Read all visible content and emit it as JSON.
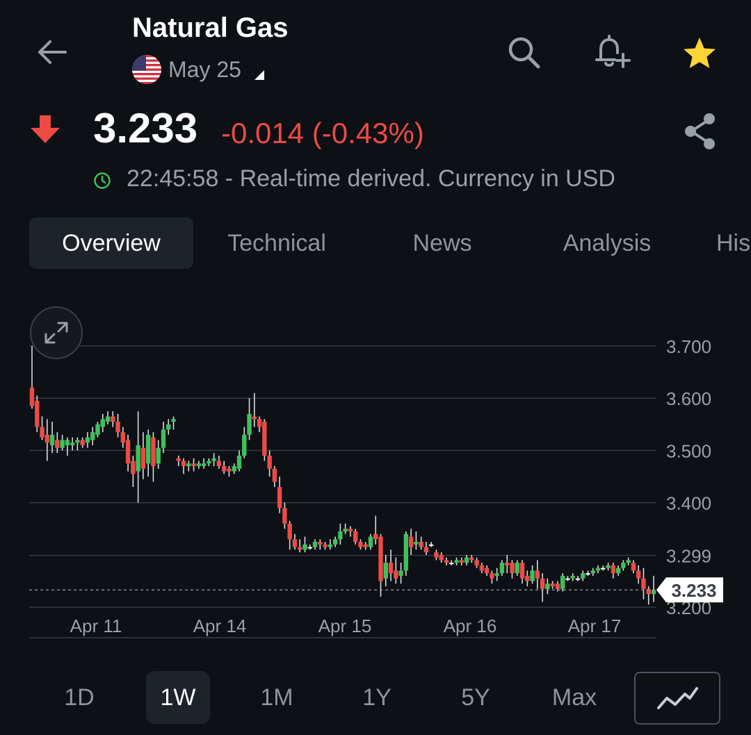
{
  "header": {
    "title": "Natural Gas",
    "contract": "May 25",
    "back_icon": "arrow-left-icon",
    "search_icon": "search-icon",
    "alert_icon": "bell-plus-icon",
    "favorite_icon": "star-icon",
    "favorite_color": "#fcd535"
  },
  "quote": {
    "price": "3.233",
    "change": "-0.014 (-0.43%)",
    "direction_icon": "arrow-down-icon",
    "down_color": "#ec4b45",
    "up_color": "#3ec15a",
    "time": "22:45:58",
    "status_text": "22:45:58 - Real-time derived. Currency in USD",
    "share_icon": "share-icon"
  },
  "tabs": [
    {
      "label": "Overview",
      "active": true
    },
    {
      "label": "Technical",
      "active": false
    },
    {
      "label": "News",
      "active": false
    },
    {
      "label": "Analysis",
      "active": false
    },
    {
      "label": "His",
      "active": false
    }
  ],
  "chart_data": {
    "type": "candlestick",
    "y_ticks": [
      "3.700",
      "3.600",
      "3.500",
      "3.400",
      "3.299",
      "3.200"
    ],
    "ylim": [
      3.2,
      3.7
    ],
    "x_ticks": [
      "Apr 11",
      "Apr 14",
      "Apr 15",
      "Apr 16",
      "Apr 17"
    ],
    "last_price_label": "3.233",
    "last_price": 3.233,
    "grid": true,
    "candles": [
      [
        3.62,
        3.585,
        3.7,
        3.58
      ],
      [
        3.595,
        3.545,
        3.605,
        3.535
      ],
      [
        3.545,
        3.525,
        3.565,
        3.52
      ],
      [
        3.53,
        3.515,
        3.56,
        3.48
      ],
      [
        3.51,
        3.53,
        3.555,
        3.495
      ],
      [
        3.52,
        3.505,
        3.535,
        3.495
      ],
      [
        3.505,
        3.52,
        3.53,
        3.5
      ],
      [
        3.51,
        3.52,
        3.525,
        3.49
      ],
      [
        3.51,
        3.515,
        3.525,
        3.5
      ],
      [
        3.515,
        3.52,
        3.525,
        3.5
      ],
      [
        3.52,
        3.51,
        3.525,
        3.505
      ],
      [
        3.515,
        3.525,
        3.535,
        3.505
      ],
      [
        3.52,
        3.535,
        3.545,
        3.51
      ],
      [
        3.53,
        3.55,
        3.555,
        3.525
      ],
      [
        3.545,
        3.56,
        3.57,
        3.535
      ],
      [
        3.555,
        3.565,
        3.575,
        3.55
      ],
      [
        3.565,
        3.555,
        3.575,
        3.545
      ],
      [
        3.555,
        3.535,
        3.57,
        3.525
      ],
      [
        3.535,
        3.515,
        3.545,
        3.505
      ],
      [
        3.52,
        3.475,
        3.53,
        3.46
      ],
      [
        3.48,
        3.455,
        3.49,
        3.43
      ],
      [
        3.46,
        3.51,
        3.575,
        3.4
      ],
      [
        3.505,
        3.465,
        3.535,
        3.445
      ],
      [
        3.475,
        3.53,
        3.54,
        3.45
      ],
      [
        3.525,
        3.47,
        3.535,
        3.44
      ],
      [
        3.475,
        3.505,
        3.52,
        3.465
      ],
      [
        3.505,
        3.54,
        3.555,
        3.495
      ],
      [
        3.54,
        3.55,
        3.56,
        3.53
      ],
      [
        3.555,
        3.56,
        3.565,
        3.54
      ],
      [
        3.485,
        3.48,
        3.49,
        3.47
      ],
      [
        3.48,
        3.47,
        3.485,
        3.455
      ],
      [
        3.47,
        3.475,
        3.48,
        3.46
      ],
      [
        3.475,
        3.47,
        3.485,
        3.46
      ],
      [
        3.47,
        3.475,
        3.48,
        3.465
      ],
      [
        3.47,
        3.475,
        3.485,
        3.465
      ],
      [
        3.475,
        3.48,
        3.485,
        3.47
      ],
      [
        3.48,
        3.485,
        3.495,
        3.47
      ],
      [
        3.48,
        3.47,
        3.49,
        3.465
      ],
      [
        3.47,
        3.46,
        3.48,
        3.455
      ],
      [
        3.465,
        3.46,
        3.47,
        3.45
      ],
      [
        3.46,
        3.47,
        3.475,
        3.455
      ],
      [
        3.465,
        3.49,
        3.5,
        3.46
      ],
      [
        3.49,
        3.53,
        3.545,
        3.485
      ],
      [
        3.53,
        3.57,
        3.6,
        3.52
      ],
      [
        3.565,
        3.56,
        3.61,
        3.545
      ],
      [
        3.56,
        3.545,
        3.565,
        3.535
      ],
      [
        3.555,
        3.49,
        3.56,
        3.48
      ],
      [
        3.49,
        3.465,
        3.5,
        3.45
      ],
      [
        3.465,
        3.44,
        3.47,
        3.43
      ],
      [
        3.43,
        3.39,
        3.45,
        3.38
      ],
      [
        3.39,
        3.36,
        3.4,
        3.35
      ],
      [
        3.36,
        3.33,
        3.365,
        3.31
      ],
      [
        3.33,
        3.315,
        3.34,
        3.31
      ],
      [
        3.315,
        3.31,
        3.33,
        3.305
      ],
      [
        3.31,
        3.32,
        3.335,
        3.305
      ],
      [
        3.315,
        3.315,
        3.32,
        3.31
      ],
      [
        3.315,
        3.325,
        3.33,
        3.31
      ],
      [
        3.325,
        3.32,
        3.33,
        3.31
      ],
      [
        3.32,
        3.315,
        3.325,
        3.31
      ],
      [
        3.315,
        3.32,
        3.33,
        3.31
      ],
      [
        3.32,
        3.33,
        3.335,
        3.315
      ],
      [
        3.33,
        3.345,
        3.36,
        3.32
      ],
      [
        3.345,
        3.35,
        3.36,
        3.34
      ],
      [
        3.35,
        3.345,
        3.355,
        3.335
      ],
      [
        3.345,
        3.325,
        3.35,
        3.32
      ],
      [
        3.325,
        3.315,
        3.33,
        3.31
      ],
      [
        3.32,
        3.315,
        3.325,
        3.31
      ],
      [
        3.315,
        3.335,
        3.34,
        3.31
      ],
      [
        3.34,
        3.33,
        3.375,
        3.32
      ],
      [
        3.335,
        3.25,
        3.34,
        3.22
      ],
      [
        3.255,
        3.285,
        3.3,
        3.24
      ],
      [
        3.285,
        3.265,
        3.31,
        3.25
      ],
      [
        3.27,
        3.255,
        3.295,
        3.245
      ],
      [
        3.26,
        3.27,
        3.285,
        3.245
      ],
      [
        3.27,
        3.34,
        3.345,
        3.26
      ],
      [
        3.335,
        3.315,
        3.35,
        3.3
      ],
      [
        3.32,
        3.325,
        3.345,
        3.31
      ],
      [
        3.325,
        3.315,
        3.335,
        3.31
      ],
      [
        3.315,
        3.305,
        3.325,
        3.3
      ],
      [
        3.32,
        3.32,
        3.325,
        3.315
      ],
      [
        3.305,
        3.295,
        3.31,
        3.29
      ],
      [
        3.3,
        3.29,
        3.305,
        3.285
      ],
      [
        3.29,
        3.285,
        3.295,
        3.28
      ],
      [
        3.285,
        3.285,
        3.29,
        3.28
      ],
      [
        3.285,
        3.29,
        3.295,
        3.28
      ],
      [
        3.29,
        3.285,
        3.295,
        3.28
      ],
      [
        3.285,
        3.295,
        3.3,
        3.28
      ],
      [
        3.295,
        3.29,
        3.3,
        3.285
      ],
      [
        3.29,
        3.28,
        3.295,
        3.275
      ],
      [
        3.28,
        3.27,
        3.285,
        3.265
      ],
      [
        3.275,
        3.265,
        3.28,
        3.26
      ],
      [
        3.265,
        3.255,
        3.27,
        3.245
      ],
      [
        3.26,
        3.265,
        3.275,
        3.25
      ],
      [
        3.265,
        3.285,
        3.29,
        3.26
      ],
      [
        3.285,
        3.28,
        3.3,
        3.265
      ],
      [
        3.285,
        3.265,
        3.29,
        3.255
      ],
      [
        3.265,
        3.285,
        3.29,
        3.26
      ],
      [
        3.285,
        3.255,
        3.29,
        3.245
      ],
      [
        3.26,
        3.25,
        3.27,
        3.24
      ],
      [
        3.25,
        3.27,
        3.28,
        3.245
      ],
      [
        3.27,
        3.255,
        3.29,
        3.235
      ],
      [
        3.255,
        3.235,
        3.265,
        3.21
      ],
      [
        3.235,
        3.245,
        3.255,
        3.225
      ],
      [
        3.245,
        3.24,
        3.25,
        3.235
      ],
      [
        3.245,
        3.235,
        3.25,
        3.23
      ],
      [
        3.235,
        3.26,
        3.265,
        3.23
      ],
      [
        3.255,
        3.255,
        3.26,
        3.25
      ],
      [
        3.255,
        3.26,
        3.265,
        3.25
      ],
      [
        3.255,
        3.255,
        3.26,
        3.25
      ],
      [
        3.255,
        3.265,
        3.27,
        3.25
      ],
      [
        3.265,
        3.265,
        3.27,
        3.26
      ],
      [
        3.265,
        3.27,
        3.275,
        3.26
      ],
      [
        3.27,
        3.275,
        3.28,
        3.265
      ],
      [
        3.275,
        3.275,
        3.28,
        3.27
      ],
      [
        3.275,
        3.28,
        3.285,
        3.27
      ],
      [
        3.28,
        3.265,
        3.285,
        3.255
      ],
      [
        3.265,
        3.275,
        3.28,
        3.26
      ],
      [
        3.275,
        3.285,
        3.29,
        3.27
      ],
      [
        3.285,
        3.29,
        3.295,
        3.28
      ],
      [
        3.285,
        3.27,
        3.29,
        3.265
      ],
      [
        3.27,
        3.255,
        3.28,
        3.245
      ],
      [
        3.255,
        3.235,
        3.275,
        3.215
      ],
      [
        3.235,
        3.225,
        3.24,
        3.205
      ],
      [
        3.225,
        3.233,
        3.26,
        3.21
      ]
    ]
  },
  "ranges": [
    {
      "label": "1D",
      "active": false
    },
    {
      "label": "1W",
      "active": true
    },
    {
      "label": "1M",
      "active": false
    },
    {
      "label": "1Y",
      "active": false
    },
    {
      "label": "5Y",
      "active": false
    },
    {
      "label": "Max",
      "active": false
    }
  ],
  "chart_controls": {
    "expand_icon": "expand-arrows-icon",
    "chart_type_icon": "line-chart-icon"
  }
}
